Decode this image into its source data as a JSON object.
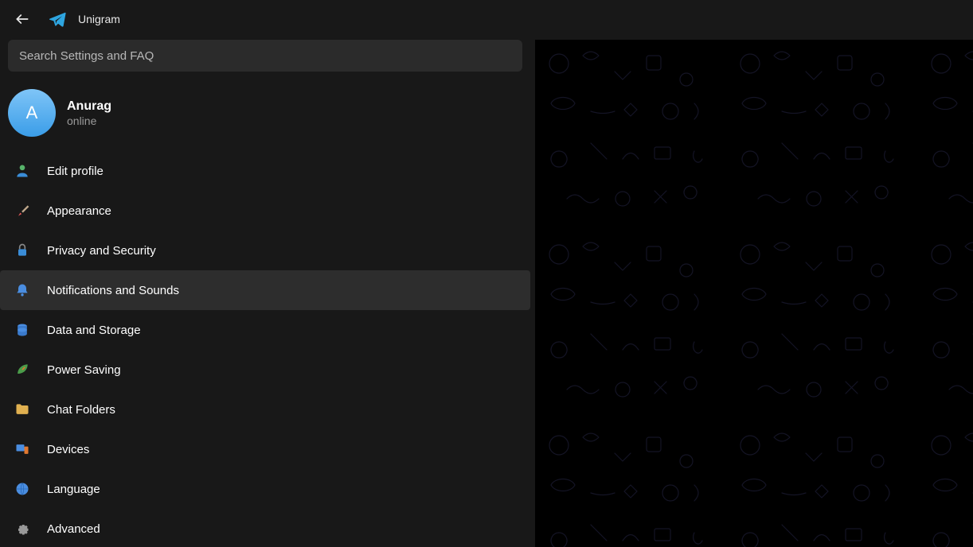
{
  "app": {
    "title": "Unigram"
  },
  "search": {
    "placeholder": "Search Settings and FAQ"
  },
  "profile": {
    "avatar_letter": "A",
    "name": "Anurag",
    "status": "online"
  },
  "settings": {
    "items": [
      {
        "id": "edit-profile",
        "label": "Edit profile",
        "icon": "person-icon",
        "selected": false
      },
      {
        "id": "appearance",
        "label": "Appearance",
        "icon": "brush-icon",
        "selected": false
      },
      {
        "id": "privacy",
        "label": "Privacy and Security",
        "icon": "lock-icon",
        "selected": false
      },
      {
        "id": "notifications",
        "label": "Notifications and Sounds",
        "icon": "bell-icon",
        "selected": true
      },
      {
        "id": "data-storage",
        "label": "Data and Storage",
        "icon": "database-icon",
        "selected": false
      },
      {
        "id": "power-saving",
        "label": "Power Saving",
        "icon": "leaf-icon",
        "selected": false
      },
      {
        "id": "chat-folders",
        "label": "Chat Folders",
        "icon": "folder-icon",
        "selected": false
      },
      {
        "id": "devices",
        "label": "Devices",
        "icon": "devices-icon",
        "selected": false
      },
      {
        "id": "language",
        "label": "Language",
        "icon": "globe-icon",
        "selected": false
      },
      {
        "id": "advanced",
        "label": "Advanced",
        "icon": "gear-icon",
        "selected": false
      }
    ]
  }
}
